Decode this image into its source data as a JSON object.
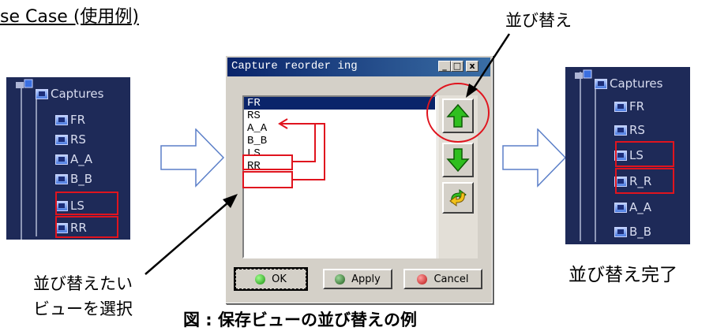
{
  "heading": "se Case (使用例)",
  "callout_reorder": "並び替え",
  "callout_select": [
    "並び替えたい",
    "ビューを選択"
  ],
  "callout_done": "並び替え完了",
  "bottom_caption": "図 : 保存ビューの並び替えの例",
  "tree_before": {
    "root": "Captures",
    "items": [
      "FR",
      "RS",
      "A_A",
      "B_B",
      "LS",
      "RR"
    ]
  },
  "tree_after": {
    "root": "Captures",
    "items": [
      "FR",
      "RS",
      "LS",
      "R_R",
      "A_A",
      "B_B"
    ]
  },
  "dialog": {
    "title": "Capture reorder ing",
    "title_buttons": [
      "_",
      "□",
      "x"
    ],
    "list": [
      "FR",
      "RS",
      "A_A",
      "B_B",
      "LS",
      "RR"
    ],
    "selected_index": 0,
    "buttons": {
      "ok": "OK",
      "apply": "Apply",
      "cancel": "Cancel"
    }
  },
  "colors": {
    "highlight": "#e0141e",
    "up_arrow": "#2fbf1f",
    "tree_bg": "#1e2a58"
  }
}
